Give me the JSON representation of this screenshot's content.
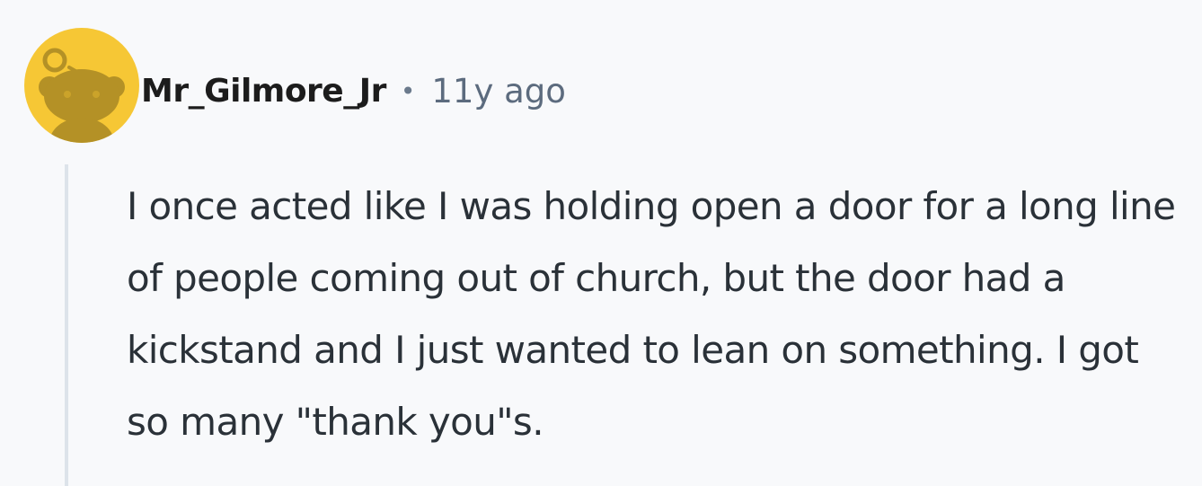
{
  "comment": {
    "author": "Mr_Gilmore_Jr",
    "separator": "•",
    "timestamp": "11y ago",
    "body": "I once acted like I was holding open a door for a long line of people coming out of church, but the door had a kickstand and I just wanted to lean on something. I got so many \"thank you\"s.",
    "avatar_icon": "snoo-avatar-icon"
  },
  "colors": {
    "avatar_background": "#f6c735",
    "avatar_figure": "#b49126",
    "username": "#1c1c1c",
    "meta": "#5c6b7e",
    "body_text": "#2a3138",
    "thread_line": "#dde3ea",
    "page_background": "#f8f9fb"
  }
}
